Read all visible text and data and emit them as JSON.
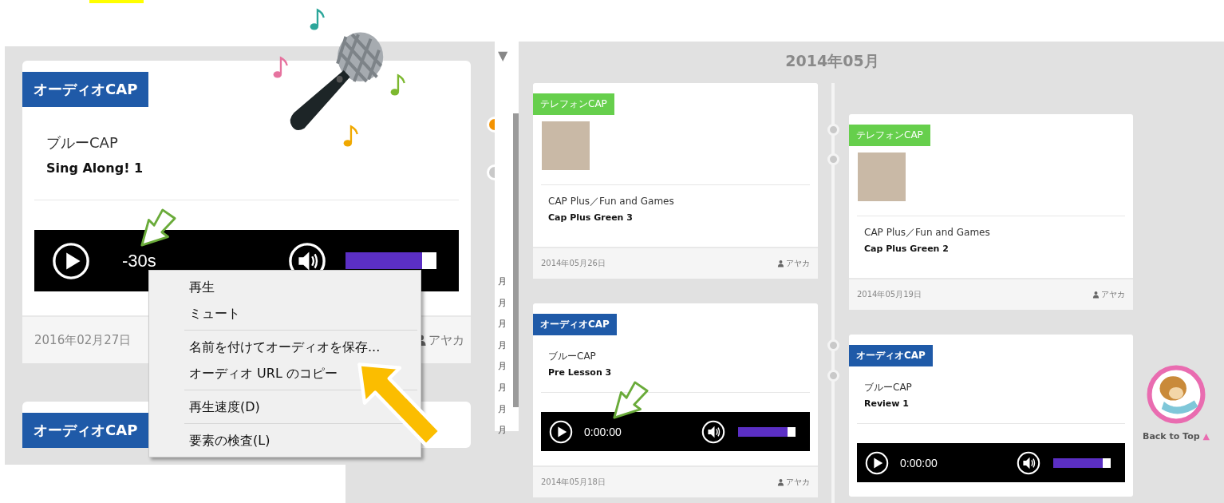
{
  "zoomed_view": {
    "cards": [
      {
        "kind": "audio",
        "tag": "オーディオCAP",
        "course": "ブルーCAP",
        "title": "Sing Along! 1",
        "player": {
          "time": "-30s",
          "level": 0.84
        },
        "date": "2016年02月27日",
        "author": "アヤカ"
      },
      {
        "kind": "audio",
        "tag": "オーディオCAP"
      }
    ]
  },
  "context_menu": {
    "groups": [
      [
        {
          "label": "再生"
        },
        {
          "label": "ミュート"
        }
      ],
      [
        {
          "label": "名前を付けてオーディオを保存..."
        },
        {
          "label": "オーディオ URL のコピー"
        }
      ],
      [
        {
          "label": "再生速度(D)"
        }
      ],
      [
        {
          "label": "要素の検査(L)"
        }
      ]
    ]
  },
  "timeline": {
    "sidebar": {
      "toggle": "▼",
      "items": [
        "月",
        "月",
        "月",
        "月",
        "月",
        "月",
        "月",
        "月"
      ]
    },
    "month": "2014年05月",
    "columns": [
      [
        {
          "kind": "telephone",
          "tag": "テレフォンCAP",
          "course": "CAP Plus／Fun and Games",
          "title": "Cap Plus Green 3",
          "date": "2014年05月26日",
          "author": "アヤカ"
        },
        {
          "kind": "audio",
          "tag": "オーディオCAP",
          "course": "ブルーCAP",
          "title": "Pre Lesson 3",
          "player": {
            "time": "0:00:00",
            "level": 0.86
          },
          "date": "2014年05月18日",
          "author": "アヤカ"
        }
      ],
      [
        {
          "kind": "telephone",
          "tag": "テレフォンCAP",
          "course": "CAP Plus／Fun and Games",
          "title": "Cap Plus Green 2",
          "date": "2014年05月19日",
          "author": "アヤカ"
        },
        {
          "kind": "audio",
          "tag": "オーディオCAP",
          "course": "ブルーCAP",
          "title": "Review 1",
          "player": {
            "time": "0:00:00",
            "level": 0.86
          }
        }
      ]
    ]
  },
  "back_to_top": {
    "label": "Back to Top",
    "arrow": "▲"
  }
}
